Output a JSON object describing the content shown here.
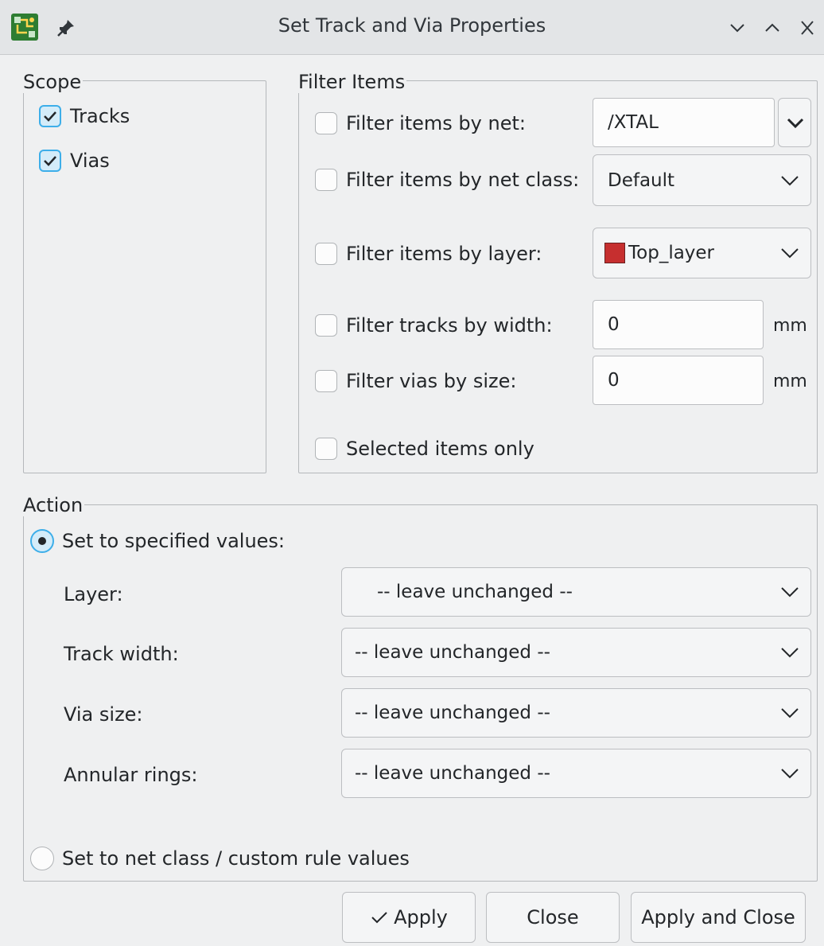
{
  "window": {
    "title": "Set Track and Via Properties"
  },
  "scope": {
    "title": "Scope",
    "items": [
      {
        "label": "Tracks",
        "checked": true
      },
      {
        "label": "Vias",
        "checked": true
      }
    ]
  },
  "filter": {
    "title": "Filter Items",
    "net": {
      "label": "Filter items by net:",
      "checked": false,
      "value": "/XTAL"
    },
    "net_class": {
      "label": "Filter items by net class:",
      "checked": false,
      "value": "Default"
    },
    "layer": {
      "label": "Filter items by layer:",
      "checked": false,
      "value": "Top_layer",
      "swatch_color": "#c62f2f"
    },
    "track_width": {
      "label": "Filter tracks by width:",
      "checked": false,
      "value": "0",
      "unit": "mm"
    },
    "via_size": {
      "label": "Filter vias by size:",
      "checked": false,
      "value": "0",
      "unit": "mm"
    },
    "selected_only": {
      "label": "Selected items only",
      "checked": false
    }
  },
  "action": {
    "title": "Action",
    "specified": {
      "label": "Set to specified values:",
      "selected": true
    },
    "layer": {
      "label": "Layer:",
      "value": "-- leave unchanged --"
    },
    "track_width": {
      "label": "Track width:",
      "value": "-- leave unchanged --"
    },
    "via_size": {
      "label": "Via size:",
      "value": "-- leave unchanged --"
    },
    "annular_rings": {
      "label": "Annular rings:",
      "value": "-- leave unchanged --"
    },
    "netclass": {
      "label": "Set to net class / custom rule values",
      "selected": false
    }
  },
  "buttons": {
    "apply": "Apply",
    "close": "Close",
    "apply_close": "Apply and Close"
  },
  "colors": {
    "accent": "#3daee9",
    "background": "#eff0f1"
  }
}
